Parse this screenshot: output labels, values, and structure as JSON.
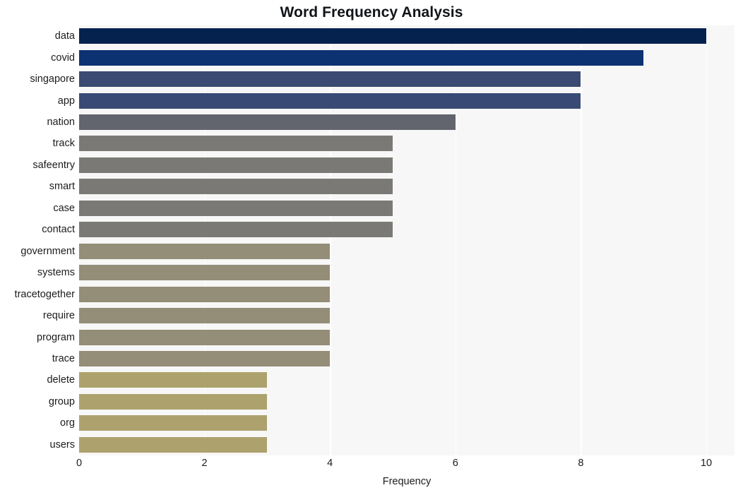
{
  "chart_data": {
    "type": "bar",
    "orientation": "horizontal",
    "title": "Word Frequency Analysis",
    "xlabel": "Frequency",
    "ylabel": "",
    "xlim": [
      0,
      10.45
    ],
    "xticks": [
      0,
      2,
      4,
      6,
      8,
      10
    ],
    "xtick_labels": [
      "0",
      "2",
      "4",
      "6",
      "8",
      "10"
    ],
    "grid": "vertical-white-on-gray",
    "legend": "none",
    "plot_background": "#f7f7f7",
    "figure_background": "#ffffff",
    "categories": [
      "data",
      "covid",
      "singapore",
      "app",
      "nation",
      "track",
      "safeentry",
      "smart",
      "case",
      "contact",
      "government",
      "systems",
      "tracetogether",
      "require",
      "program",
      "trace",
      "delete",
      "group",
      "org",
      "users"
    ],
    "values": [
      10,
      9,
      8,
      8,
      6,
      5,
      5,
      5,
      5,
      5,
      4,
      4,
      4,
      4,
      4,
      4,
      3,
      3,
      3,
      3
    ],
    "bar_colors": [
      "#05224f",
      "#0d3272",
      "#3a4a72",
      "#394a75",
      "#62656d",
      "#7b7975",
      "#7b7975",
      "#7b7975",
      "#7b7975",
      "#7b7975",
      "#948d77",
      "#948d77",
      "#948d77",
      "#948d77",
      "#948d77",
      "#948d77",
      "#ada26e",
      "#ada26e",
      "#ada26e",
      "#ada26e"
    ]
  }
}
